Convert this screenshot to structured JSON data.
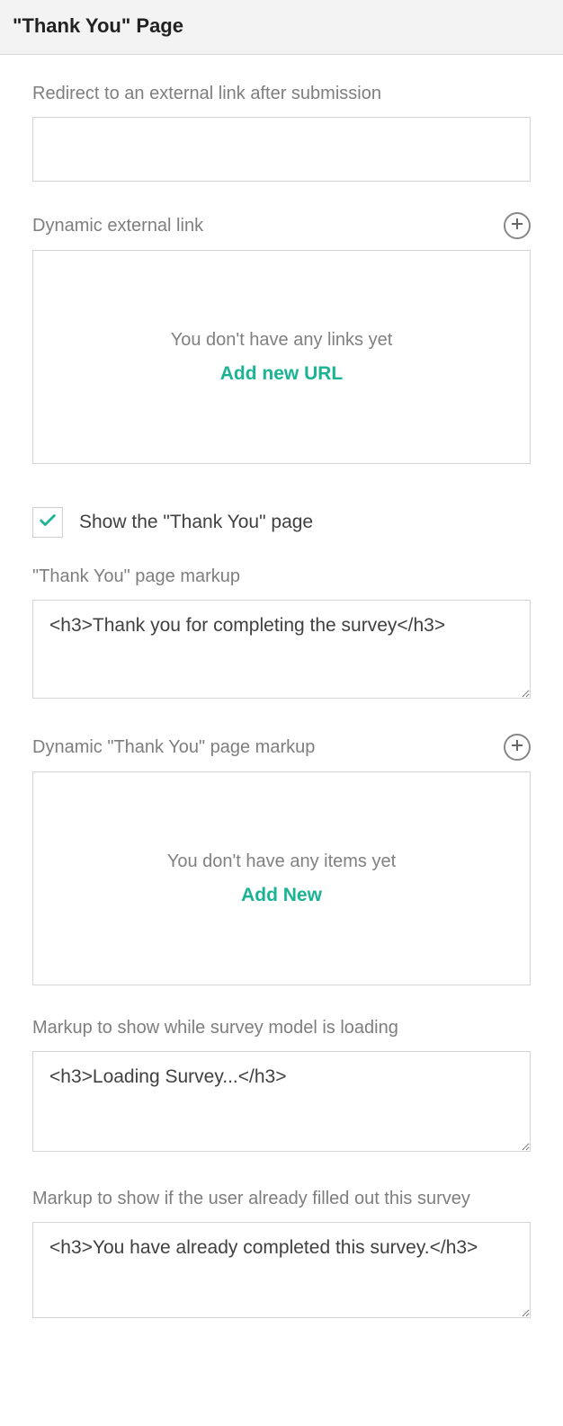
{
  "header": {
    "title": "\"Thank You\" Page"
  },
  "redirect": {
    "label": "Redirect to an external link after submission",
    "value": ""
  },
  "dynamicLink": {
    "label": "Dynamic external link",
    "emptyText": "You don't have any links yet",
    "addLabel": "Add new URL"
  },
  "showThankYou": {
    "label": "Show the \"Thank You\" page",
    "checked": true
  },
  "markup": {
    "label": "\"Thank You\" page markup",
    "value": "<h3>Thank you for completing the survey</h3>"
  },
  "dynamicMarkup": {
    "label": "Dynamic \"Thank You\" page markup",
    "emptyText": "You don't have any items yet",
    "addLabel": "Add New"
  },
  "loading": {
    "label": "Markup to show while survey model is loading",
    "value": "<h3>Loading Survey...</h3>"
  },
  "already": {
    "label": "Markup to show if the user already filled out this survey",
    "value": "<h3>You have already completed this survey.</h3>"
  }
}
